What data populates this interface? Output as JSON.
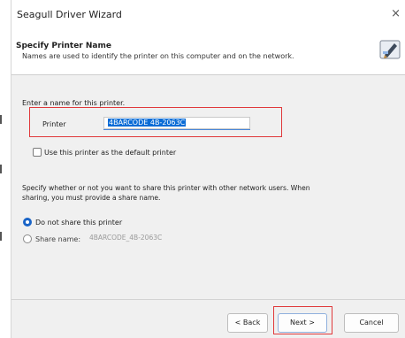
{
  "window": {
    "title": "Seagull Driver Wizard",
    "close_glyph": "×"
  },
  "header": {
    "title": "Specify Printer Name",
    "subtitle": "Names are used to identify the printer on this computer and on the network.",
    "icon": "printer-wizard-icon"
  },
  "form": {
    "name_prompt": "Enter a name for this printer.",
    "printer_label": "Printer",
    "printer_value": "4BARCODE 4B-2063C",
    "default_checkbox_label": "Use this printer as the default printer",
    "default_checked": false,
    "share_prompt_line1": "Specify whether or not you want to share this printer with other network users.  When",
    "share_prompt_line2": "sharing, you must provide a share name.",
    "share_options": {
      "do_not_share_label": "Do not share this printer",
      "share_name_label": "Share name:",
      "share_name_value": "4BARCODE_4B-2063C",
      "selected": "do_not_share"
    }
  },
  "buttons": {
    "back": "< Back",
    "next": "Next >",
    "cancel": "Cancel"
  },
  "colors": {
    "highlight": "#e0393b",
    "accent": "#1a64c7"
  }
}
